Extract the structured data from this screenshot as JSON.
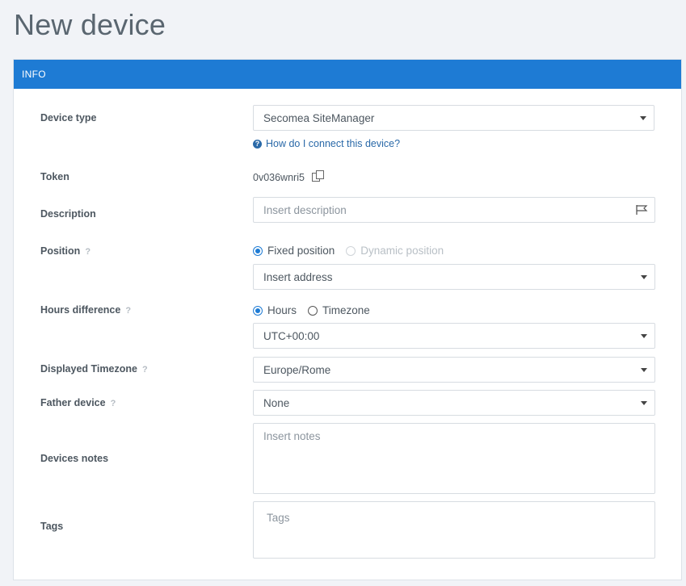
{
  "page": {
    "title": "New device"
  },
  "panel": {
    "header": "INFO"
  },
  "fields": {
    "device_type": {
      "label": "Device type",
      "value": "Secomea SiteManager",
      "help_link": "How do I connect this device?"
    },
    "token": {
      "label": "Token",
      "value": "0v036wnri5"
    },
    "description": {
      "label": "Description",
      "placeholder": "Insert description"
    },
    "position": {
      "label": "Position",
      "help": "?",
      "options": [
        "Fixed position",
        "Dynamic position"
      ],
      "selected": "Fixed position",
      "address_placeholder": "Insert address"
    },
    "hours_difference": {
      "label": "Hours difference",
      "help": "?",
      "options": [
        "Hours",
        "Timezone"
      ],
      "selected": "Hours",
      "value": "UTC+00:00"
    },
    "displayed_timezone": {
      "label": "Displayed Timezone",
      "help": "?",
      "value": "Europe/Rome"
    },
    "father_device": {
      "label": "Father device",
      "help": "?",
      "value": "None"
    },
    "devices_notes": {
      "label": "Devices notes",
      "placeholder": "Insert notes"
    },
    "tags": {
      "label": "Tags",
      "placeholder": "Tags"
    }
  },
  "colors": {
    "accent": "#1e7bd4",
    "link": "#2a69a8",
    "background": "#f1f3f7"
  }
}
